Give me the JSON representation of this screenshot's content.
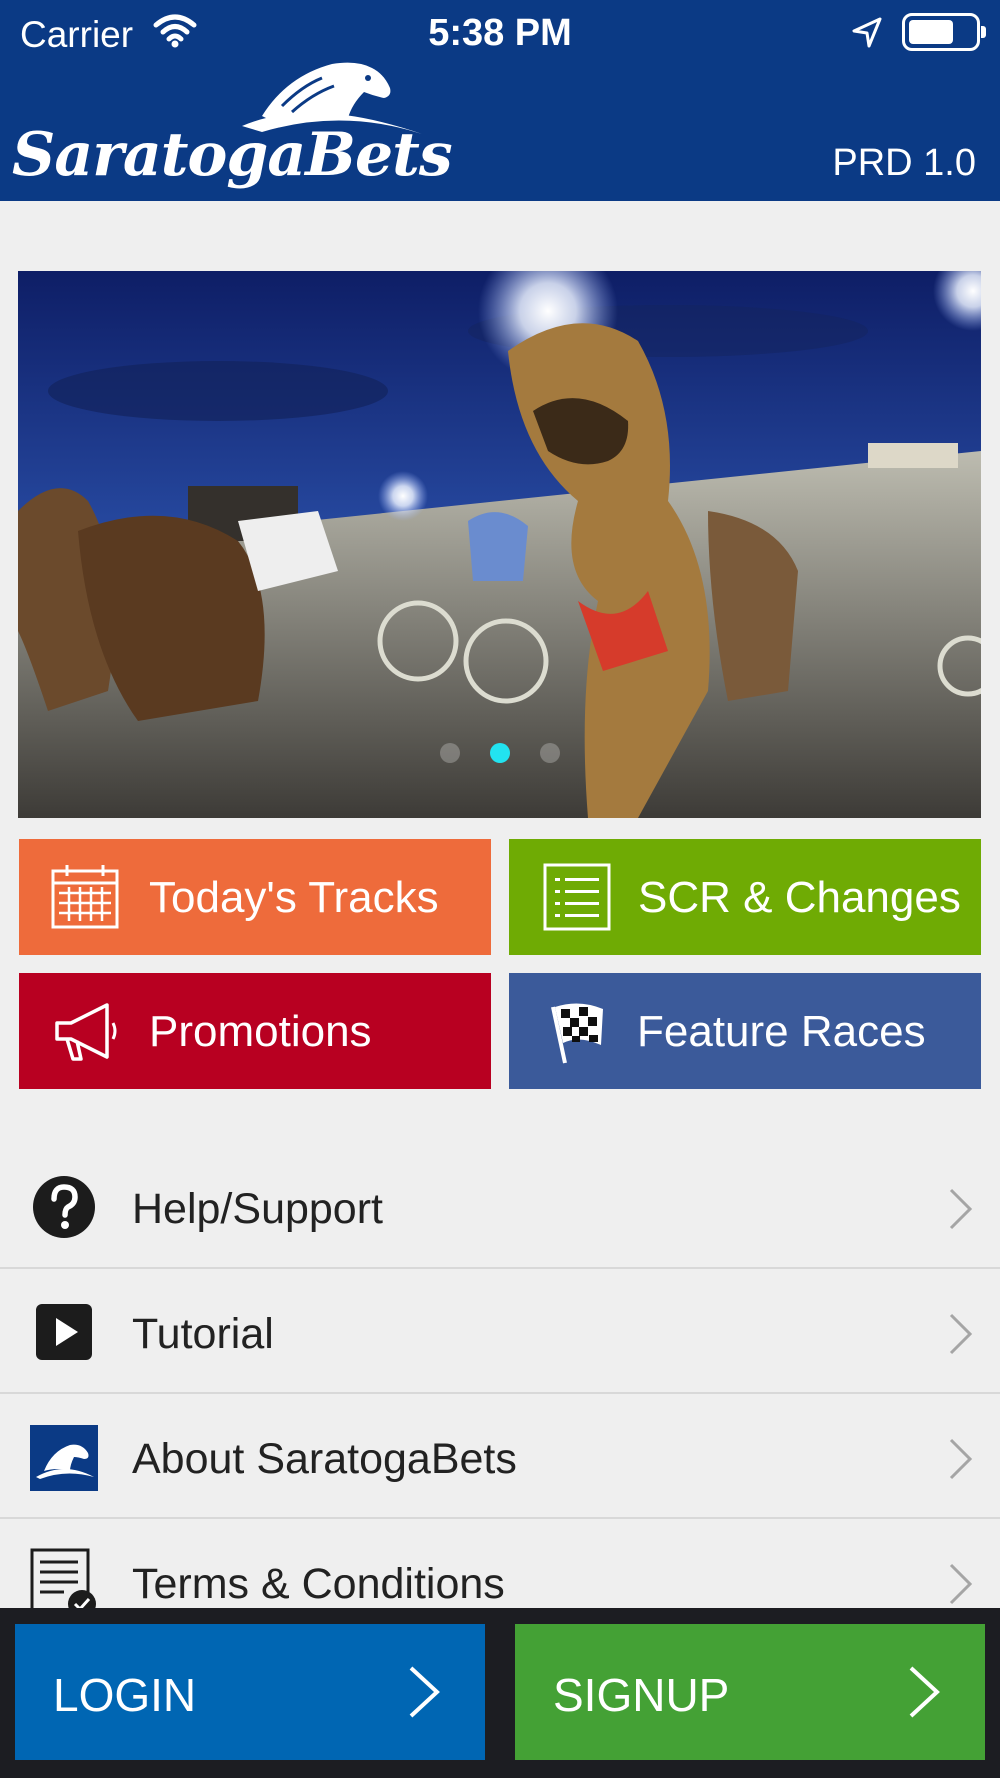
{
  "status_bar": {
    "carrier": "Carrier",
    "time": "5:38 PM"
  },
  "header": {
    "logo_text": "SaratogaBets",
    "version": "PRD 1.0"
  },
  "carousel": {
    "page_count": 3,
    "active_index": 1,
    "active_color": "#22e3f0"
  },
  "tiles": [
    {
      "label": "Today's Tracks",
      "icon": "calendar-icon",
      "color": "#ee6b3b"
    },
    {
      "label": "SCR & Changes",
      "icon": "list-icon",
      "color": "#6fab04"
    },
    {
      "label": "Promotions",
      "icon": "megaphone-icon",
      "color": "#b80021"
    },
    {
      "label": "Feature Races",
      "icon": "checkered-flag-icon",
      "color": "#3b5a9a"
    }
  ],
  "menu": [
    {
      "label": "Help/Support",
      "icon": "question-icon"
    },
    {
      "label": "Tutorial",
      "icon": "play-icon"
    },
    {
      "label": "About SaratogaBets",
      "icon": "saratoga-logo-icon"
    },
    {
      "label": "Terms & Conditions",
      "icon": "document-check-icon"
    }
  ],
  "bottom": {
    "login_label": "LOGIN",
    "signup_label": "SIGNUP",
    "login_color": "#0066b3",
    "signup_color": "#44a135"
  }
}
